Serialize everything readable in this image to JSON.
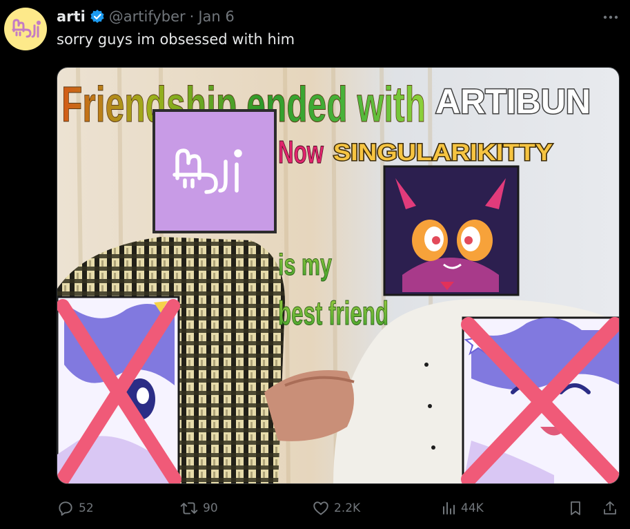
{
  "tweet": {
    "author_name": "arti",
    "handle": "@artifyber",
    "separator": "·",
    "date": "Jan 6",
    "text": "sorry guys im obsessed with him"
  },
  "meme": {
    "line1_a": "Friendship ended with",
    "line1_b": "ARTIBUN",
    "line2_a": "Now",
    "line2_b": "SINGULARIKITTY",
    "line3": "is my",
    "line4": "best friend"
  },
  "actions": {
    "replies": "52",
    "reposts": "90",
    "likes": "2.2K",
    "views": "44K"
  },
  "colors": {
    "accent_blue": "#1d9bf0",
    "muted_text": "#71767b",
    "avatar_bg": "#fde98a",
    "cross_red": "#f05a78"
  },
  "icons": [
    "logo-icon",
    "verified-badge-icon",
    "more-icon",
    "reply-icon",
    "repost-icon",
    "like-icon",
    "views-icon",
    "bookmark-icon",
    "share-icon"
  ]
}
